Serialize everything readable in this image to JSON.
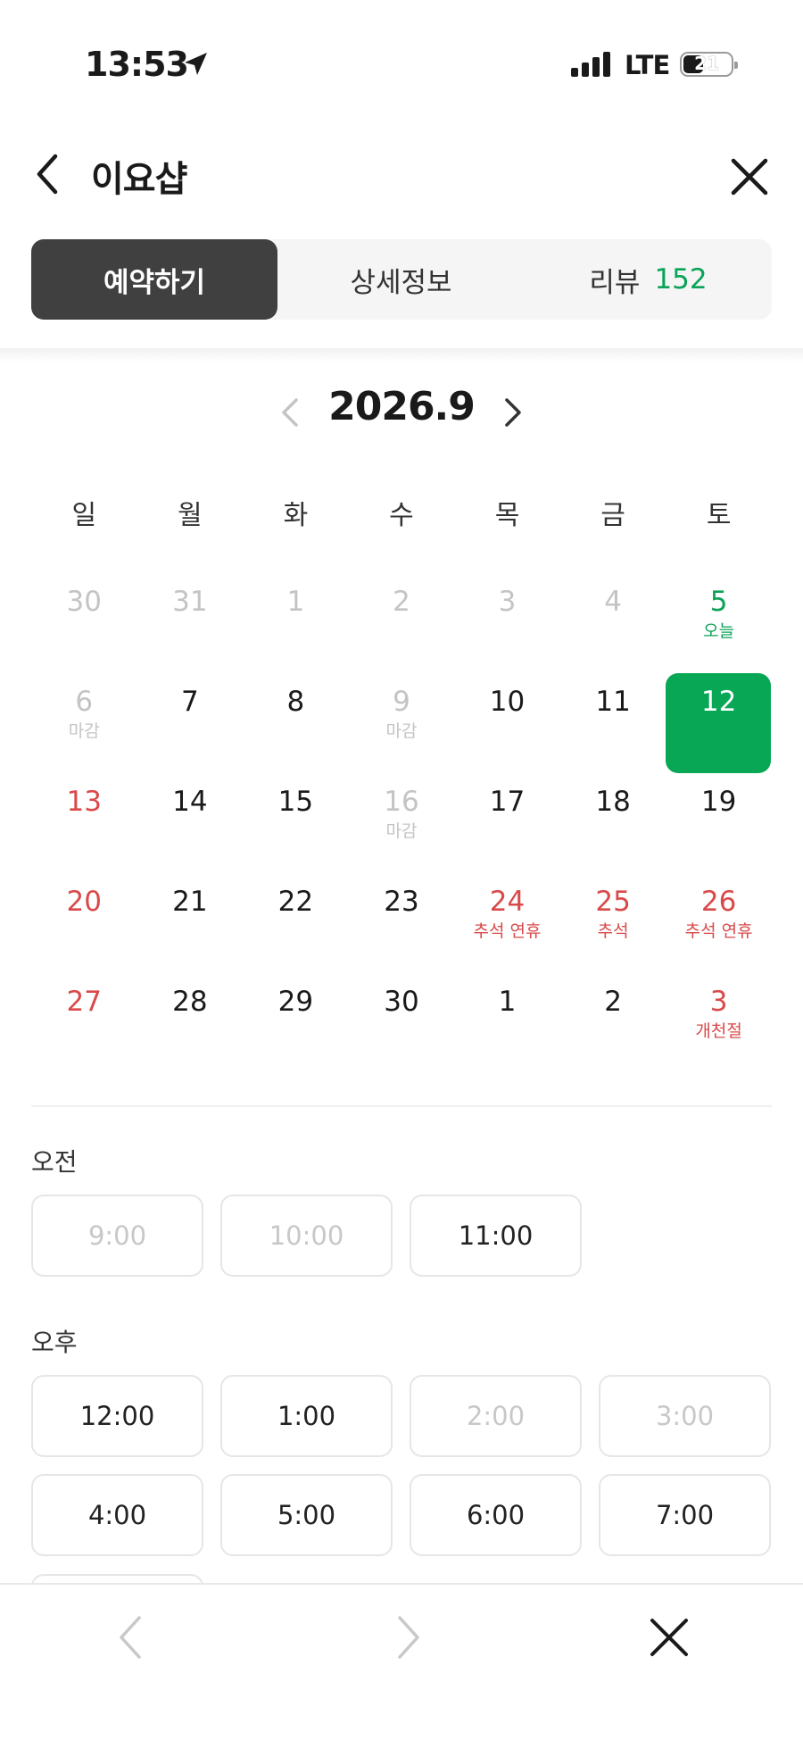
{
  "status_bar": {
    "time": "13:53",
    "network": "LTE",
    "battery": "21"
  },
  "header": {
    "title": "이요샵"
  },
  "tabs": [
    {
      "label": "예약하기",
      "active": true
    },
    {
      "label": "상세정보"
    },
    {
      "label": "리뷰",
      "count": "152"
    }
  ],
  "calendar": {
    "month_label": "2026.9",
    "weekdays": [
      "일",
      "월",
      "화",
      "수",
      "목",
      "금",
      "토"
    ],
    "weeks": [
      [
        {
          "num": "30",
          "state": "muted"
        },
        {
          "num": "31",
          "state": "muted"
        },
        {
          "num": "1",
          "state": "muted"
        },
        {
          "num": "2",
          "state": "muted"
        },
        {
          "num": "3",
          "state": "muted"
        },
        {
          "num": "4",
          "state": "muted"
        },
        {
          "num": "5",
          "sub": "오늘",
          "state": "today"
        }
      ],
      [
        {
          "num": "6",
          "sub": "마감",
          "state": "muted"
        },
        {
          "num": "7",
          "state": "normal"
        },
        {
          "num": "8",
          "state": "normal"
        },
        {
          "num": "9",
          "sub": "마감",
          "state": "muted"
        },
        {
          "num": "10",
          "state": "normal"
        },
        {
          "num": "11",
          "state": "normal"
        },
        {
          "num": "12",
          "state": "selected"
        }
      ],
      [
        {
          "num": "13",
          "state": "holiday"
        },
        {
          "num": "14",
          "state": "normal"
        },
        {
          "num": "15",
          "state": "normal"
        },
        {
          "num": "16",
          "sub": "마감",
          "state": "muted"
        },
        {
          "num": "17",
          "state": "normal"
        },
        {
          "num": "18",
          "state": "normal"
        },
        {
          "num": "19",
          "state": "normal"
        }
      ],
      [
        {
          "num": "20",
          "state": "holiday"
        },
        {
          "num": "21",
          "state": "normal"
        },
        {
          "num": "22",
          "state": "normal"
        },
        {
          "num": "23",
          "state": "normal"
        },
        {
          "num": "24",
          "sub": "추석 연휴",
          "state": "holiday"
        },
        {
          "num": "25",
          "sub": "추석",
          "state": "holiday"
        },
        {
          "num": "26",
          "sub": "추석 연휴",
          "state": "holiday"
        }
      ],
      [
        {
          "num": "27",
          "state": "holiday"
        },
        {
          "num": "28",
          "state": "normal"
        },
        {
          "num": "29",
          "state": "normal"
        },
        {
          "num": "30",
          "state": "normal"
        },
        {
          "num": "1",
          "state": "normal"
        },
        {
          "num": "2",
          "state": "normal"
        },
        {
          "num": "3",
          "sub": "개천절",
          "state": "holiday"
        }
      ]
    ]
  },
  "times": {
    "am_label": "오전",
    "am": [
      {
        "label": "9:00",
        "disabled": true
      },
      {
        "label": "10:00",
        "disabled": true
      },
      {
        "label": "11:00",
        "disabled": false
      }
    ],
    "pm_label": "오후",
    "pm": [
      {
        "label": "12:00",
        "disabled": false
      },
      {
        "label": "1:00",
        "disabled": false
      },
      {
        "label": "2:00",
        "disabled": true
      },
      {
        "label": "3:00",
        "disabled": true
      },
      {
        "label": "4:00",
        "disabled": false
      },
      {
        "label": "5:00",
        "disabled": false
      },
      {
        "label": "6:00",
        "disabled": false
      },
      {
        "label": "7:00",
        "disabled": false
      }
    ]
  },
  "colors": {
    "accent": "#07a755",
    "holiday": "#d94a4a",
    "tab_active_bg": "#404040"
  }
}
